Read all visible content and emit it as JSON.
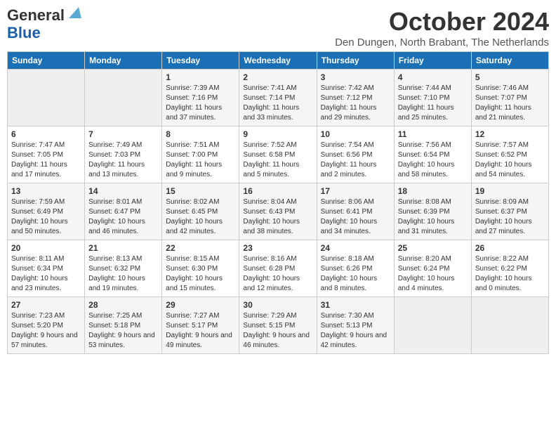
{
  "logo": {
    "line1": "General",
    "line2": "Blue"
  },
  "title": "October 2024",
  "subtitle": "Den Dungen, North Brabant, The Netherlands",
  "calendar": {
    "headers": [
      "Sunday",
      "Monday",
      "Tuesday",
      "Wednesday",
      "Thursday",
      "Friday",
      "Saturday"
    ],
    "rows": [
      [
        {
          "day": "",
          "info": ""
        },
        {
          "day": "",
          "info": ""
        },
        {
          "day": "1",
          "info": "Sunrise: 7:39 AM\nSunset: 7:16 PM\nDaylight: 11 hours and 37 minutes."
        },
        {
          "day": "2",
          "info": "Sunrise: 7:41 AM\nSunset: 7:14 PM\nDaylight: 11 hours and 33 minutes."
        },
        {
          "day": "3",
          "info": "Sunrise: 7:42 AM\nSunset: 7:12 PM\nDaylight: 11 hours and 29 minutes."
        },
        {
          "day": "4",
          "info": "Sunrise: 7:44 AM\nSunset: 7:10 PM\nDaylight: 11 hours and 25 minutes."
        },
        {
          "day": "5",
          "info": "Sunrise: 7:46 AM\nSunset: 7:07 PM\nDaylight: 11 hours and 21 minutes."
        }
      ],
      [
        {
          "day": "6",
          "info": "Sunrise: 7:47 AM\nSunset: 7:05 PM\nDaylight: 11 hours and 17 minutes."
        },
        {
          "day": "7",
          "info": "Sunrise: 7:49 AM\nSunset: 7:03 PM\nDaylight: 11 hours and 13 minutes."
        },
        {
          "day": "8",
          "info": "Sunrise: 7:51 AM\nSunset: 7:00 PM\nDaylight: 11 hours and 9 minutes."
        },
        {
          "day": "9",
          "info": "Sunrise: 7:52 AM\nSunset: 6:58 PM\nDaylight: 11 hours and 5 minutes."
        },
        {
          "day": "10",
          "info": "Sunrise: 7:54 AM\nSunset: 6:56 PM\nDaylight: 11 hours and 2 minutes."
        },
        {
          "day": "11",
          "info": "Sunrise: 7:56 AM\nSunset: 6:54 PM\nDaylight: 10 hours and 58 minutes."
        },
        {
          "day": "12",
          "info": "Sunrise: 7:57 AM\nSunset: 6:52 PM\nDaylight: 10 hours and 54 minutes."
        }
      ],
      [
        {
          "day": "13",
          "info": "Sunrise: 7:59 AM\nSunset: 6:49 PM\nDaylight: 10 hours and 50 minutes."
        },
        {
          "day": "14",
          "info": "Sunrise: 8:01 AM\nSunset: 6:47 PM\nDaylight: 10 hours and 46 minutes."
        },
        {
          "day": "15",
          "info": "Sunrise: 8:02 AM\nSunset: 6:45 PM\nDaylight: 10 hours and 42 minutes."
        },
        {
          "day": "16",
          "info": "Sunrise: 8:04 AM\nSunset: 6:43 PM\nDaylight: 10 hours and 38 minutes."
        },
        {
          "day": "17",
          "info": "Sunrise: 8:06 AM\nSunset: 6:41 PM\nDaylight: 10 hours and 34 minutes."
        },
        {
          "day": "18",
          "info": "Sunrise: 8:08 AM\nSunset: 6:39 PM\nDaylight: 10 hours and 31 minutes."
        },
        {
          "day": "19",
          "info": "Sunrise: 8:09 AM\nSunset: 6:37 PM\nDaylight: 10 hours and 27 minutes."
        }
      ],
      [
        {
          "day": "20",
          "info": "Sunrise: 8:11 AM\nSunset: 6:34 PM\nDaylight: 10 hours and 23 minutes."
        },
        {
          "day": "21",
          "info": "Sunrise: 8:13 AM\nSunset: 6:32 PM\nDaylight: 10 hours and 19 minutes."
        },
        {
          "day": "22",
          "info": "Sunrise: 8:15 AM\nSunset: 6:30 PM\nDaylight: 10 hours and 15 minutes."
        },
        {
          "day": "23",
          "info": "Sunrise: 8:16 AM\nSunset: 6:28 PM\nDaylight: 10 hours and 12 minutes."
        },
        {
          "day": "24",
          "info": "Sunrise: 8:18 AM\nSunset: 6:26 PM\nDaylight: 10 hours and 8 minutes."
        },
        {
          "day": "25",
          "info": "Sunrise: 8:20 AM\nSunset: 6:24 PM\nDaylight: 10 hours and 4 minutes."
        },
        {
          "day": "26",
          "info": "Sunrise: 8:22 AM\nSunset: 6:22 PM\nDaylight: 10 hours and 0 minutes."
        }
      ],
      [
        {
          "day": "27",
          "info": "Sunrise: 7:23 AM\nSunset: 5:20 PM\nDaylight: 9 hours and 57 minutes."
        },
        {
          "day": "28",
          "info": "Sunrise: 7:25 AM\nSunset: 5:18 PM\nDaylight: 9 hours and 53 minutes."
        },
        {
          "day": "29",
          "info": "Sunrise: 7:27 AM\nSunset: 5:17 PM\nDaylight: 9 hours and 49 minutes."
        },
        {
          "day": "30",
          "info": "Sunrise: 7:29 AM\nSunset: 5:15 PM\nDaylight: 9 hours and 46 minutes."
        },
        {
          "day": "31",
          "info": "Sunrise: 7:30 AM\nSunset: 5:13 PM\nDaylight: 9 hours and 42 minutes."
        },
        {
          "day": "",
          "info": ""
        },
        {
          "day": "",
          "info": ""
        }
      ]
    ]
  }
}
